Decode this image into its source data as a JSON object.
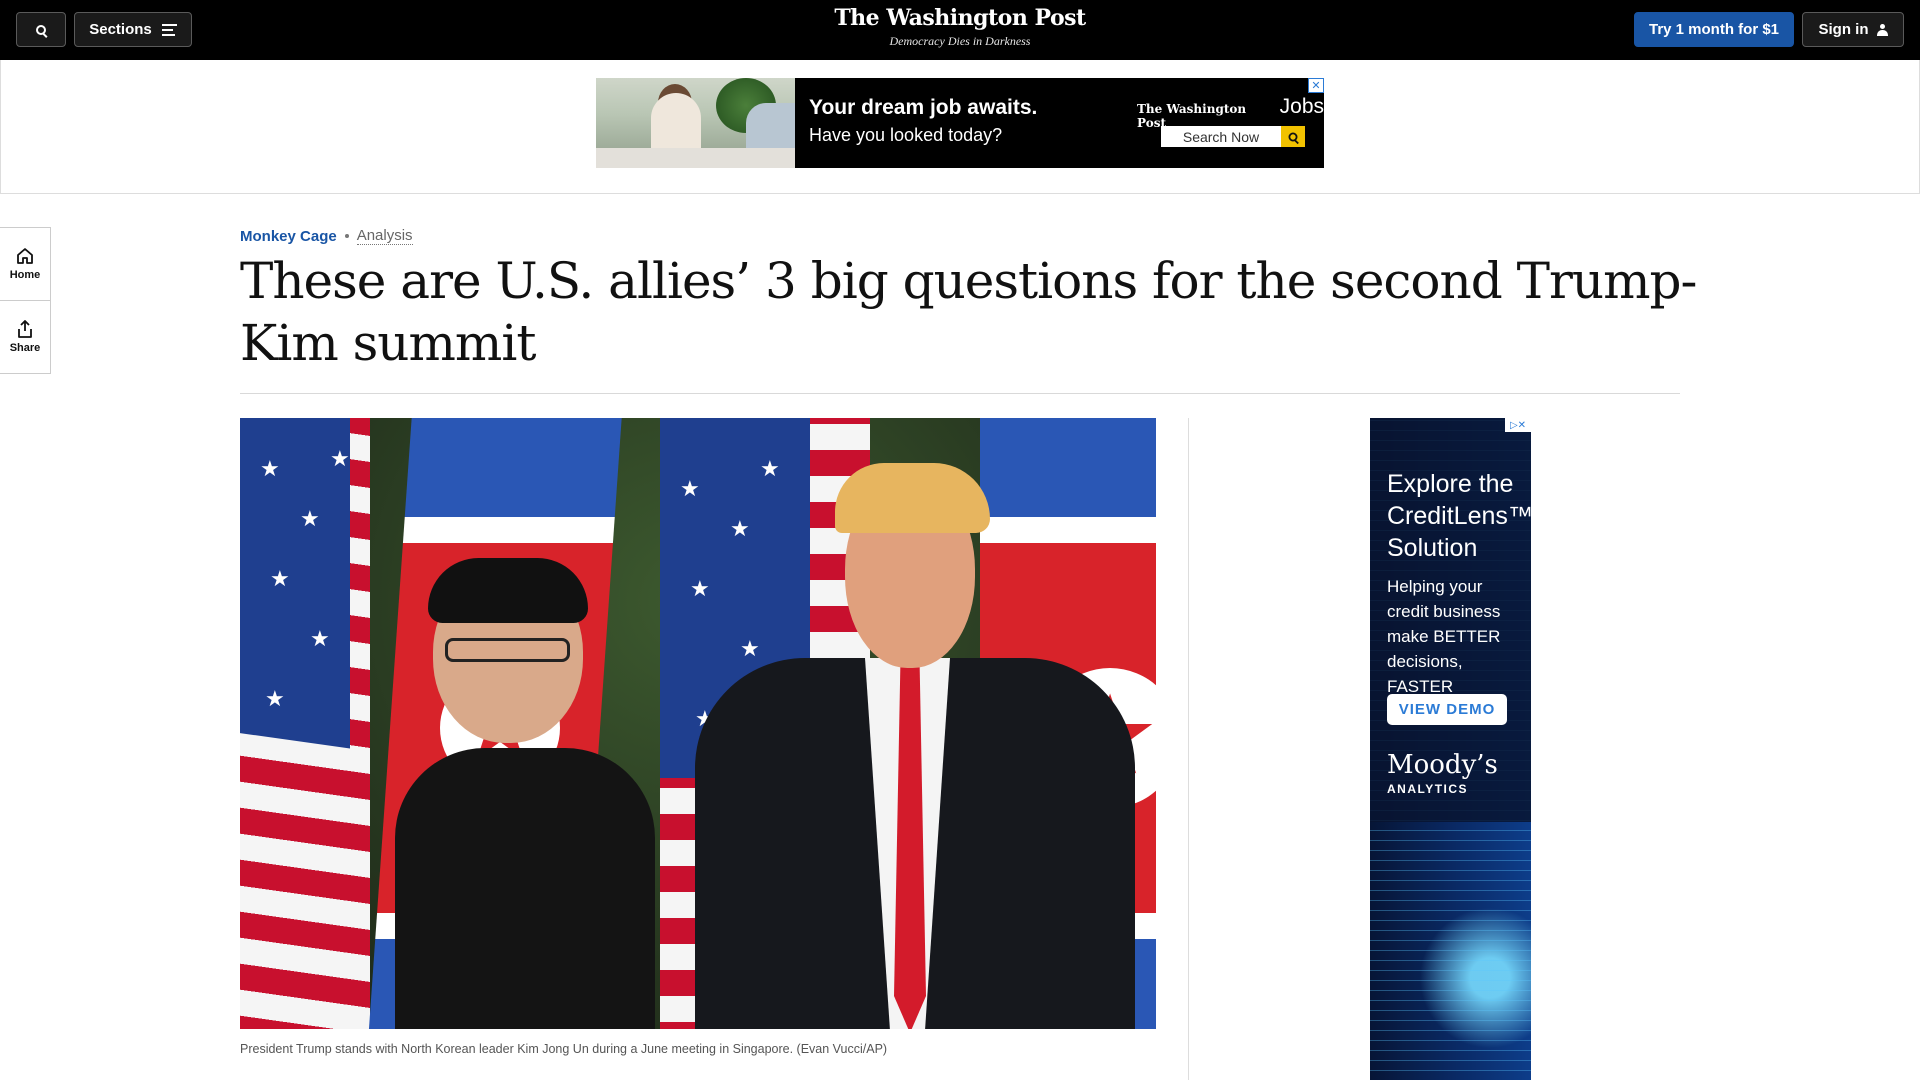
{
  "topbar": {
    "sections_label": "Sections",
    "logo_name": "The Washington Post",
    "logo_tagline": "Democracy Dies in Darkness",
    "subscribe_label": "Try 1 month for $1",
    "signin_label": "Sign in",
    "accent_color": "#1955a5"
  },
  "banner_ad": {
    "headline": "Your dream job awaits.",
    "subline": "Have you looked today?",
    "brand": "The Washington Post",
    "brand_suffix": "Jobs",
    "search_label": "Search Now",
    "close_icon": "close-icon"
  },
  "rail": {
    "home_label": "Home",
    "share_label": "Share"
  },
  "article": {
    "section": "Monkey Cage",
    "label": "Analysis",
    "headline": "These are U.S. allies’ 3 big questions for the second Trump-Kim summit",
    "caption": "President Trump stands with North Korean leader Kim Jong Un during a June meeting in Singapore. (Evan Vucci/AP)"
  },
  "side_ad": {
    "headline": "Explore the CreditLens™ Solution",
    "body": "Helping your credit business make BETTER decisions, FASTER",
    "cta": "VIEW DEMO",
    "brand": "Moody’s",
    "brand_sub": "ANALYTICS"
  }
}
